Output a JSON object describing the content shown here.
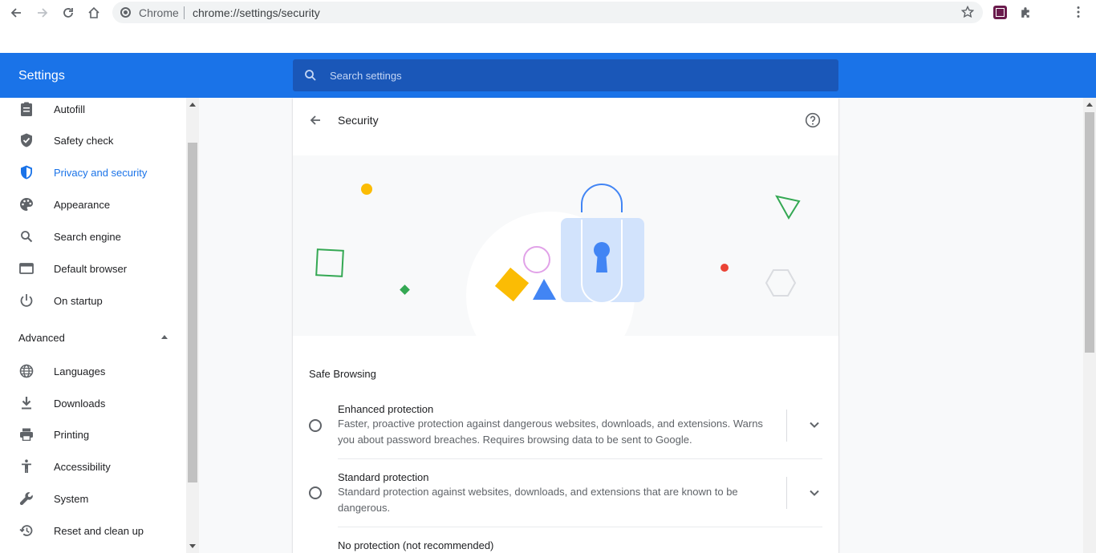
{
  "browser": {
    "site_name": "Chrome",
    "url": "chrome://settings/security"
  },
  "header": {
    "title": "Settings",
    "search_placeholder": "Search settings"
  },
  "sidebar": {
    "items": [
      {
        "label": "Autofill",
        "icon": "clipboard-icon"
      },
      {
        "label": "Safety check",
        "icon": "shield-check-icon"
      },
      {
        "label": "Privacy and security",
        "icon": "shield-half-icon",
        "active": true
      },
      {
        "label": "Appearance",
        "icon": "palette-icon"
      },
      {
        "label": "Search engine",
        "icon": "search-icon"
      },
      {
        "label": "Default browser",
        "icon": "browser-window-icon"
      },
      {
        "label": "On startup",
        "icon": "power-icon"
      }
    ],
    "advanced_label": "Advanced",
    "advanced_items": [
      {
        "label": "Languages",
        "icon": "globe-icon"
      },
      {
        "label": "Downloads",
        "icon": "download-icon"
      },
      {
        "label": "Printing",
        "icon": "printer-icon"
      },
      {
        "label": "Accessibility",
        "icon": "accessibility-icon"
      },
      {
        "label": "System",
        "icon": "wrench-icon"
      },
      {
        "label": "Reset and clean up",
        "icon": "history-icon"
      }
    ]
  },
  "page": {
    "title": "Security",
    "section_title": "Safe Browsing",
    "options": [
      {
        "title": "Enhanced protection",
        "description": "Faster, proactive protection against dangerous websites, downloads, and extensions. Warns you about password breaches. Requires browsing data to be sent to Google."
      },
      {
        "title": "Standard protection",
        "description": "Standard protection against websites, downloads, and extensions that are known to be dangerous."
      },
      {
        "title": "No protection (not recommended)",
        "description": ""
      }
    ]
  },
  "colors": {
    "accent": "#1a73e8",
    "header_bg": "#1a73e8",
    "search_bg": "#1a57b8"
  }
}
